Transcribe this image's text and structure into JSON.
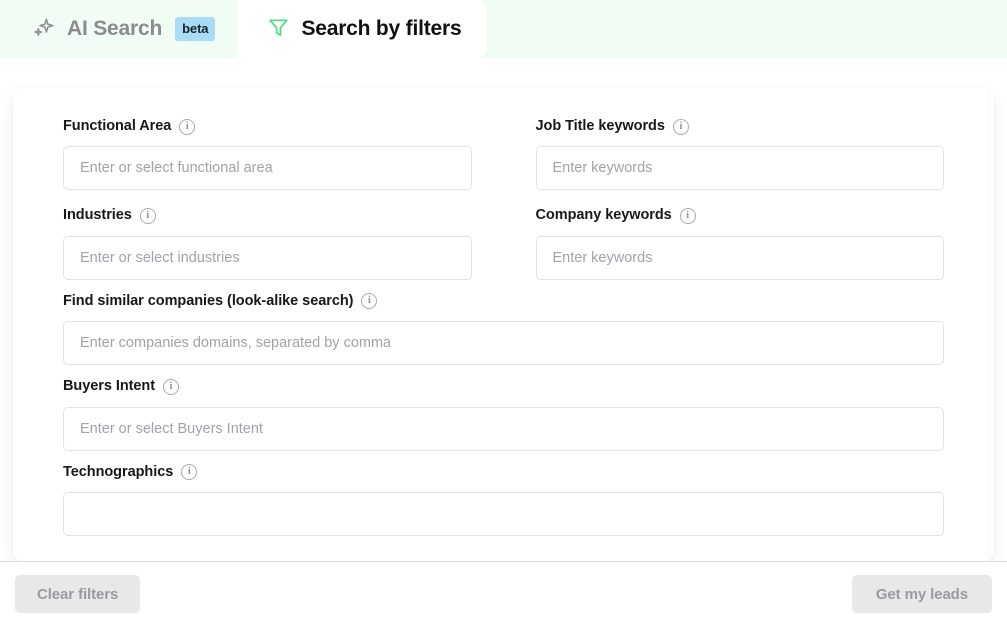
{
  "tabs": [
    {
      "id": "ai-search",
      "label": "AI Search",
      "icon": "sparkle-icon",
      "badge": "beta",
      "active": false
    },
    {
      "id": "search-by-filters",
      "label": "Search by filters",
      "icon": "funnel-icon",
      "badge": null,
      "active": true
    }
  ],
  "colors": {
    "tabbar_background": "#f1fdf4",
    "active_tab_background": "#ffffff",
    "badge_background": "#aadcf7",
    "funnel_icon": "#4ade80",
    "button_background": "#e8e8e8",
    "button_text": "#9a9aa0"
  },
  "form": {
    "fields": [
      {
        "id": "functional-area",
        "label": "Functional Area",
        "placeholder": "Enter or select functional area",
        "value": "",
        "info": "info-icon",
        "width": "half"
      },
      {
        "id": "job-title-keywords",
        "label": "Job Title keywords",
        "placeholder": "Enter keywords",
        "value": "",
        "info": "info-icon",
        "width": "half"
      },
      {
        "id": "industries",
        "label": "Industries",
        "placeholder": "Enter or select industries",
        "value": "",
        "info": "info-icon",
        "width": "half"
      },
      {
        "id": "company-keywords",
        "label": "Company keywords",
        "placeholder": "Enter keywords",
        "value": "",
        "info": "info-icon",
        "width": "half"
      },
      {
        "id": "find-similar-companies",
        "label": "Find similar companies (look-alike search)",
        "placeholder": "Enter companies domains, separated by comma",
        "value": "",
        "info": "info-icon",
        "width": "full"
      },
      {
        "id": "buyers-intent",
        "label": "Buyers Intent",
        "placeholder": "Enter or select Buyers Intent",
        "value": "",
        "info": "info-icon",
        "width": "full"
      },
      {
        "id": "technographics",
        "label": "Technographics",
        "placeholder": "",
        "value": "",
        "info": "info-icon",
        "width": "full"
      }
    ],
    "info_glyph": "i"
  },
  "footer": {
    "clear_label": "Clear filters",
    "submit_label": "Get my leads"
  }
}
